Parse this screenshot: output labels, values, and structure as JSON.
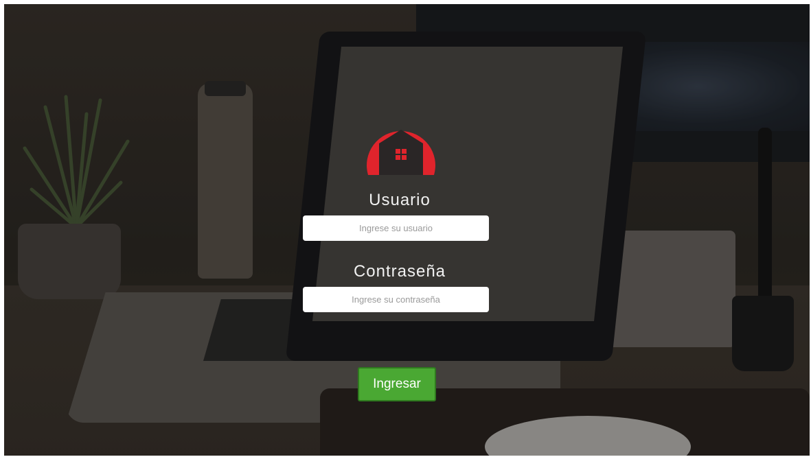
{
  "login": {
    "username_label": "Usuario",
    "username_placeholder": "Ingrese su usuario",
    "username_value": "",
    "password_label": "Contraseña",
    "password_placeholder": "Ingrese su contraseña",
    "password_value": "",
    "submit_label": "Ingresar"
  },
  "colors": {
    "logo_red": "#e0242c",
    "logo_dark": "#2a2626",
    "button_green": "#4aa833",
    "label_text": "#f1f1f1"
  },
  "icons": {
    "logo": "house-icon"
  }
}
